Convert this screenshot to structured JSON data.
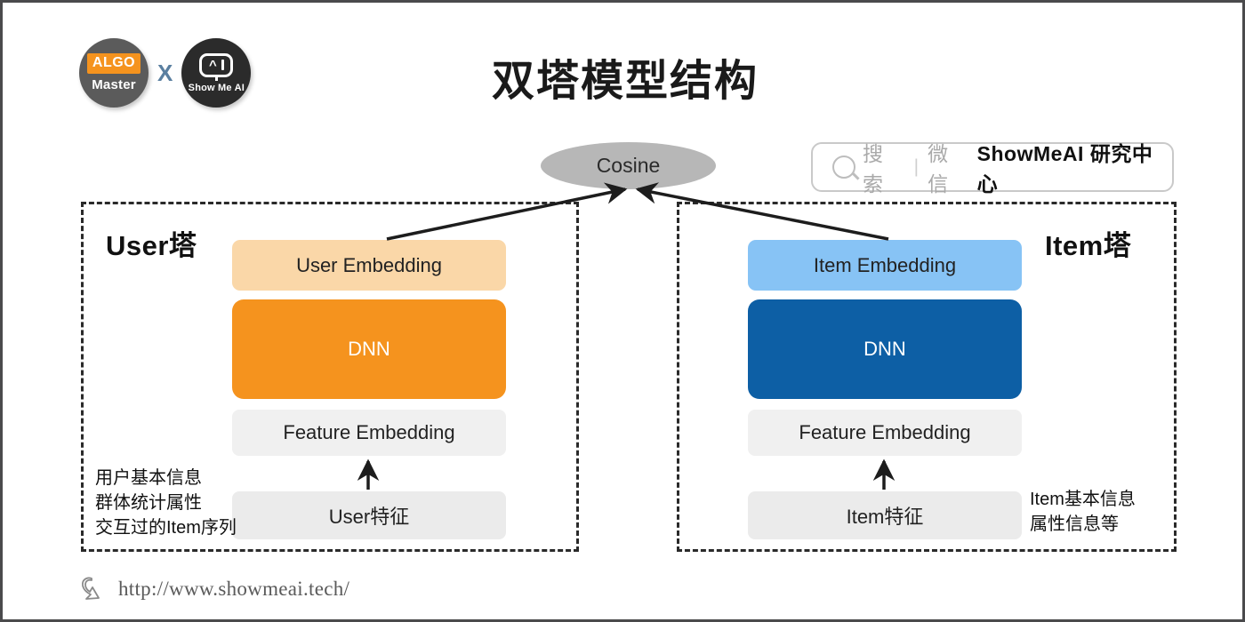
{
  "page": {
    "title": "双塔模型结构",
    "border_color": "#4a4a4c"
  },
  "logos": {
    "algo": {
      "top": "ALGO",
      "bottom": "Master"
    },
    "separator": "X",
    "showmeai": {
      "text": "Show Me AI"
    }
  },
  "search": {
    "placeholder_gray": "搜索",
    "separator": "|",
    "channel": "微信",
    "brand": "ShowMeAI 研究中心"
  },
  "similarity": {
    "label": "Cosine",
    "color": "#b7b7b7"
  },
  "towers": [
    {
      "id": "user",
      "label": "User塔",
      "accent": "#f5931e",
      "embedding_color": "#fad7a8",
      "boxes": {
        "embedding": "User Embedding",
        "dnn": "DNN",
        "feature_embedding": "Feature Embedding",
        "raw_features": "User特征"
      },
      "notes": [
        "用户基本信息",
        "群体统计属性",
        "交互过的Item序列"
      ]
    },
    {
      "id": "item",
      "label": "Item塔",
      "accent": "#0d5fa5",
      "embedding_color": "#87c3f5",
      "boxes": {
        "embedding": "Item Embedding",
        "dnn": "DNN",
        "feature_embedding": "Feature Embedding",
        "raw_features": "Item特征"
      },
      "notes": [
        "Item基本信息",
        "属性信息等"
      ]
    }
  ],
  "footer": {
    "url": "http://www.showmeai.tech/"
  }
}
